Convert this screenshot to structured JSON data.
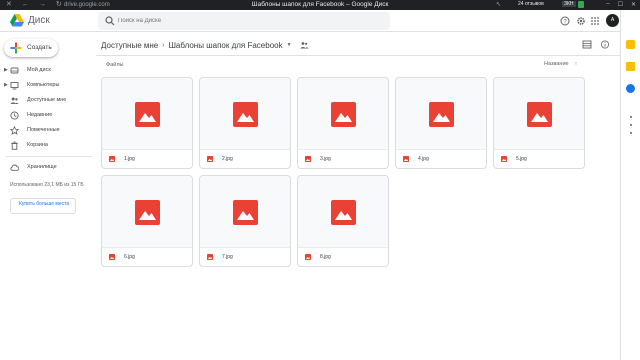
{
  "browser": {
    "url": "drive.google.com",
    "window_title": "Шаблоны шапок для Facebook – Google Диск",
    "badge_text": "24 отзывов",
    "ext_label": "ЗКН"
  },
  "header": {
    "brand": "Диск",
    "search_placeholder": "Поиск на Диске",
    "avatar_letter": "A"
  },
  "sidebar": {
    "create_label": "Создать",
    "items": [
      {
        "label": "Мой диск",
        "icon": "drive-icon",
        "expandable": true
      },
      {
        "label": "Компьютеры",
        "icon": "computer-icon",
        "expandable": true
      },
      {
        "label": "Доступные мне",
        "icon": "people-icon",
        "expandable": false
      },
      {
        "label": "Недавние",
        "icon": "clock-icon",
        "expandable": false
      },
      {
        "label": "Помеченные",
        "icon": "star-icon",
        "expandable": false
      },
      {
        "label": "Корзина",
        "icon": "trash-icon",
        "expandable": false
      }
    ],
    "storage_label": "Хранилище",
    "storage_usage": "Использовано 23,1 МБ из 15 ГБ",
    "buy_label": "Купить больше места"
  },
  "main": {
    "breadcrumb_root": "Доступные мне",
    "breadcrumb_folder": "Шаблоны шапок для Facebook",
    "section_label": "Файлы",
    "sort_label": "Название",
    "files": [
      {
        "name": "1.jpg"
      },
      {
        "name": "2.jpg"
      },
      {
        "name": "3.jpg"
      },
      {
        "name": "4.jpg"
      },
      {
        "name": "5.jpg"
      },
      {
        "name": "6.jpg"
      },
      {
        "name": "7.jpg"
      },
      {
        "name": "8.jpg"
      }
    ]
  },
  "colors": {
    "image_red": "#e94235",
    "accent_blue": "#1a73e8"
  }
}
